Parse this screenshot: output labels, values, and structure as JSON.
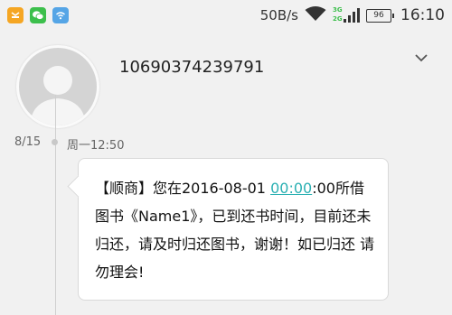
{
  "status_bar": {
    "net_speed": "50B/s",
    "net_type_top": "3G",
    "net_type_bottom": "2G",
    "battery": "96",
    "time": "16:10",
    "icons": [
      "notification-app-icon",
      "wechat-icon",
      "wifi-app-icon",
      "wifi-signal-icon",
      "cell-signal-icon",
      "battery-icon"
    ]
  },
  "conversation": {
    "sender_number": "10690374239791"
  },
  "message": {
    "date": "8/15",
    "time": "周一12:50",
    "text_before": "【顺商】您在2016-08-01 ",
    "link_text": "00:00",
    "text_after": ":00所借图书《Name1》，已到还书时间，目前还未归还，请及时归还图书，谢谢！如已归还 请勿理会!"
  },
  "colors": {
    "background": "#f1f1f1",
    "bubble": "#ffffff",
    "link": "#2bb0b3",
    "accent_green": "#3cbf4c"
  }
}
